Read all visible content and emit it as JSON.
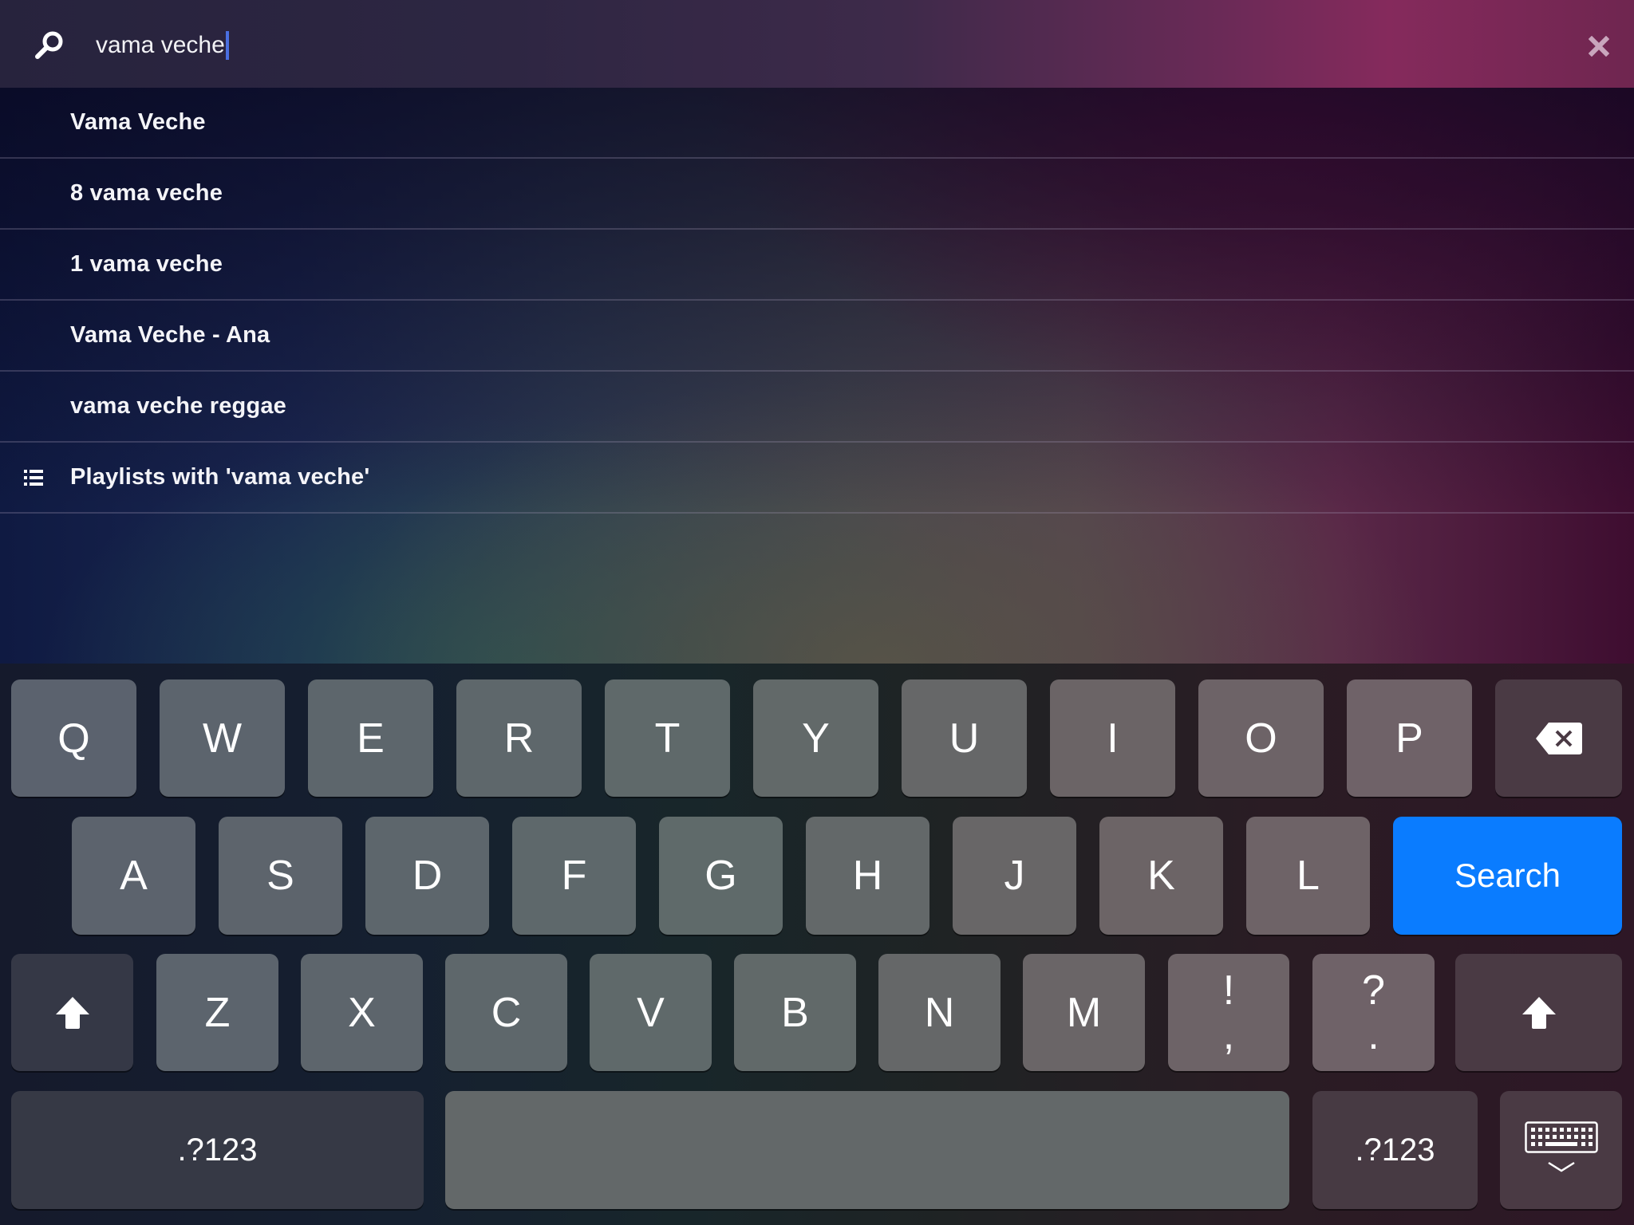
{
  "header": {
    "search_query": "vama veche",
    "search_icon": "search-icon",
    "clear_icon": "close-icon"
  },
  "results": [
    {
      "label": "Vama Veche",
      "icon": null
    },
    {
      "label": "8 vama veche",
      "icon": null
    },
    {
      "label": "1 vama veche",
      "icon": null
    },
    {
      "label": "Vama Veche - Ana",
      "icon": null
    },
    {
      "label": "vama veche reggae",
      "icon": null
    },
    {
      "label": "Playlists with 'vama veche'",
      "icon": "list-icon"
    }
  ],
  "keyboard": {
    "row1": [
      "Q",
      "W",
      "E",
      "R",
      "T",
      "Y",
      "U",
      "I",
      "O",
      "P"
    ],
    "row2": [
      "A",
      "S",
      "D",
      "F",
      "G",
      "H",
      "J",
      "K",
      "L"
    ],
    "row3": [
      "Z",
      "X",
      "C",
      "V",
      "B",
      "N",
      "M"
    ],
    "punct1": {
      "top": "!",
      "bottom": ","
    },
    "punct2": {
      "top": "?",
      "bottom": "."
    },
    "backspace_icon": "backspace-icon",
    "shift_icon": "shift-icon",
    "search_label": "Search",
    "numbers_label": ".?123",
    "space_label": "",
    "dismiss_icon": "keyboard-dismiss-icon"
  },
  "colors": {
    "accent": "#0a7cff",
    "caret": "#4a6fe0"
  }
}
